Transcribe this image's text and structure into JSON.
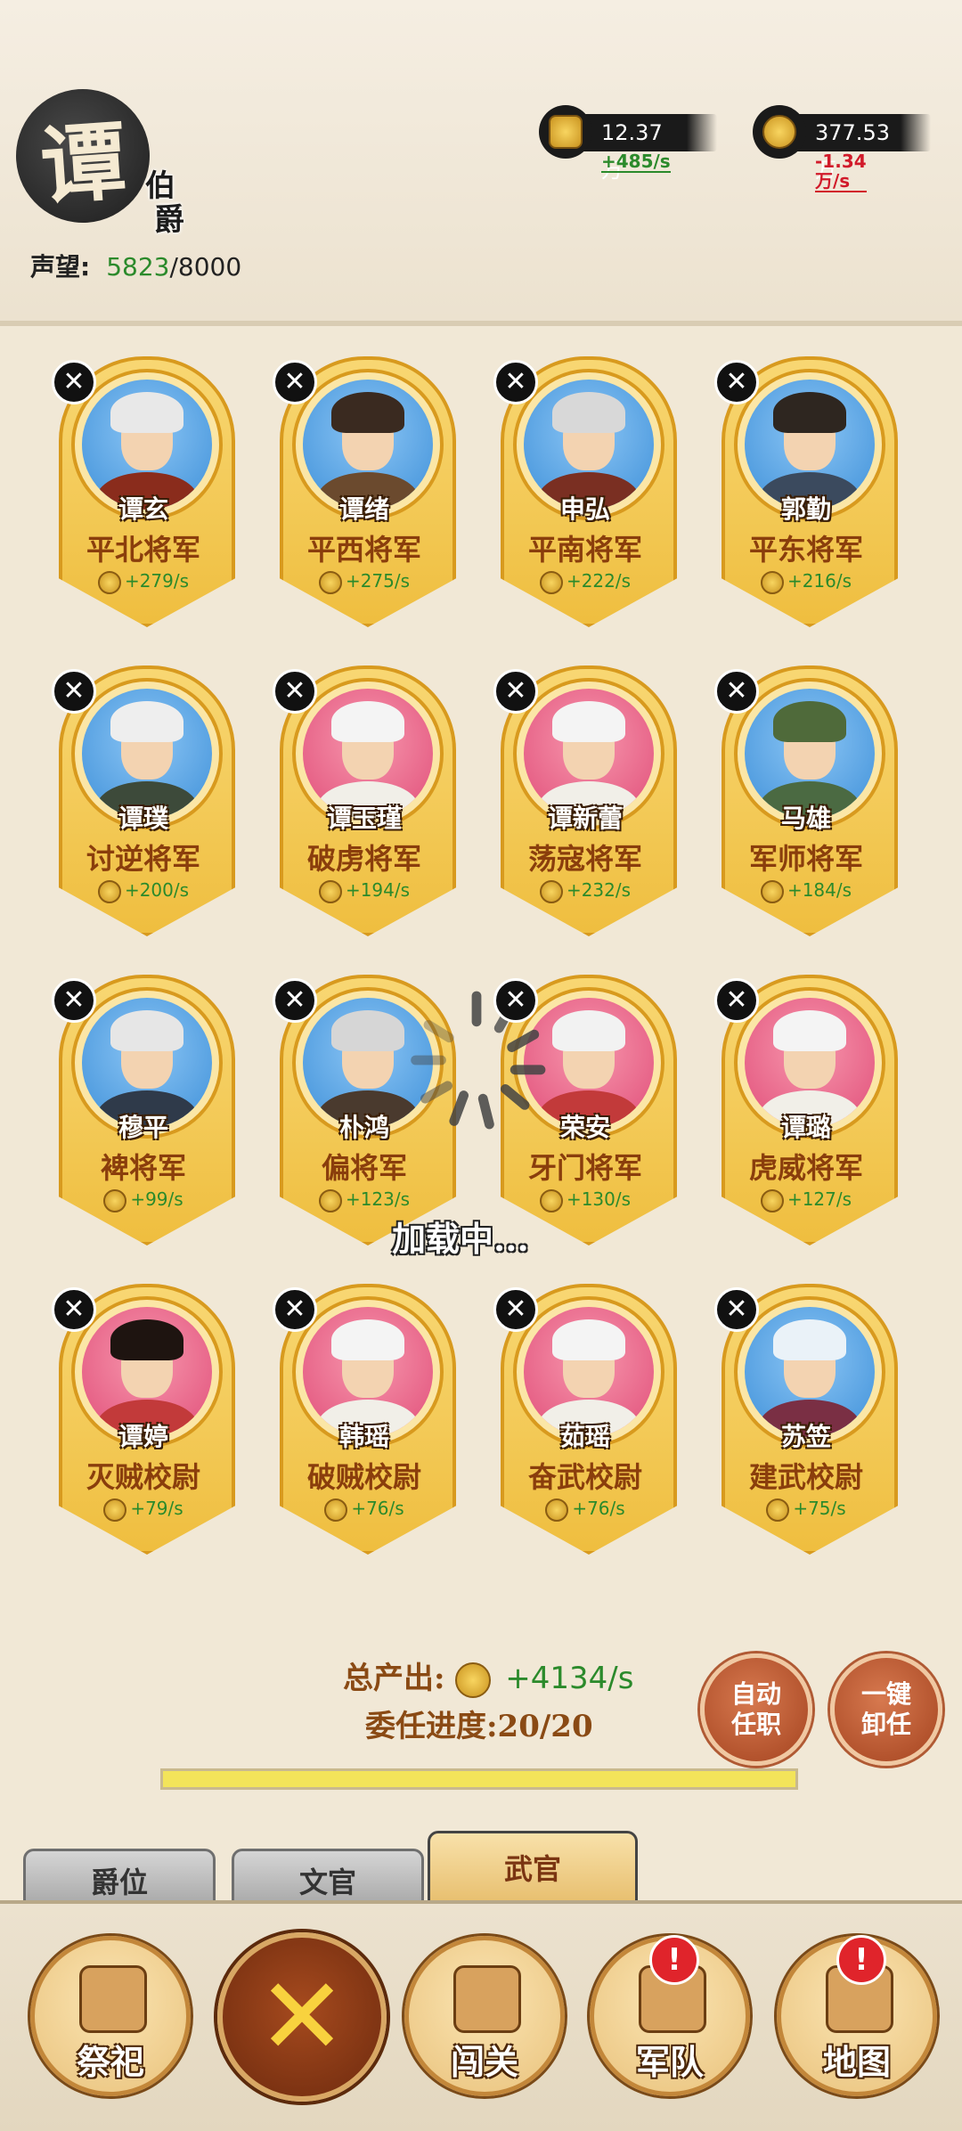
{
  "header": {
    "rank_char": "谭",
    "rank_title": [
      "伯",
      "爵"
    ],
    "reputation_label": "声望:",
    "reputation_current": "5823",
    "reputation_max": "/8000",
    "resources": [
      {
        "icon": "grain-icon",
        "amount": "12.37万",
        "rate": "+485/s",
        "rate_color": "#2b8a2b"
      },
      {
        "icon": "coin-icon",
        "amount": "377.53万",
        "rate": "-1.34万/s",
        "rate_color": "#d11a2a"
      }
    ]
  },
  "officers": [
    {
      "name": "谭玄",
      "title": "平北将军",
      "output": "+279/s",
      "bg": "blue",
      "hair": "#e8e8e8",
      "robe": "#8a2c1c"
    },
    {
      "name": "谭绪",
      "title": "平西将军",
      "output": "+275/s",
      "bg": "blue",
      "hair": "#3a2a20",
      "robe": "#6b4a2e"
    },
    {
      "name": "申弘",
      "title": "平南将军",
      "output": "+222/s",
      "bg": "blue",
      "hair": "#d8d8d8",
      "robe": "#7a2f22"
    },
    {
      "name": "郭勤",
      "title": "平东将军",
      "output": "+216/s",
      "bg": "blue",
      "hair": "#2e2620",
      "robe": "#3b4a5e"
    },
    {
      "name": "谭璞",
      "title": "讨逆将军",
      "output": "+200/s",
      "bg": "blue",
      "hair": "#eeeeee",
      "robe": "#3d4a3a"
    },
    {
      "name": "谭玉瑾",
      "title": "破虏将军",
      "output": "+194/s",
      "bg": "pink",
      "hair": "#f4f4f4",
      "robe": "#f1efe8"
    },
    {
      "name": "谭新蕾",
      "title": "荡寇将军",
      "output": "+232/s",
      "bg": "pink",
      "hair": "#f4f4f4",
      "robe": "#f1efe8"
    },
    {
      "name": "马雄",
      "title": "军师将军",
      "output": "+184/s",
      "bg": "blue",
      "hair": "#4f6a3a",
      "robe": "#4b6a42"
    },
    {
      "name": "穆平",
      "title": "裨将军",
      "output": "+99/s",
      "bg": "blue",
      "hair": "#e6e6e6",
      "robe": "#2f3a4a"
    },
    {
      "name": "朴鸿",
      "title": "偏将军",
      "output": "+123/s",
      "bg": "blue",
      "hair": "#d6d6d6",
      "robe": "#4a3a2e"
    },
    {
      "name": "荣安",
      "title": "牙门将军",
      "output": "+130/s",
      "bg": "pink",
      "hair": "#f2f2f2",
      "robe": "#c23a3a"
    },
    {
      "name": "谭璐",
      "title": "虎威将军",
      "output": "+127/s",
      "bg": "pink",
      "hair": "#f4f4f4",
      "robe": "#f1efe8"
    },
    {
      "name": "谭婷",
      "title": "灭贼校尉",
      "output": "+79/s",
      "bg": "pink",
      "hair": "#1e1410",
      "robe": "#c23a3a"
    },
    {
      "name": "韩瑶",
      "title": "破贼校尉",
      "output": "+76/s",
      "bg": "pink",
      "hair": "#f4f4f4",
      "robe": "#f1efe8"
    },
    {
      "name": "茹瑶",
      "title": "奋武校尉",
      "output": "+76/s",
      "bg": "pink",
      "hair": "#f4f4f4",
      "robe": "#f1efe8"
    },
    {
      "name": "苏笠",
      "title": "建武校尉",
      "output": "+75/s",
      "bg": "blue",
      "hair": "#eaf2f8",
      "robe": "#7a2f44"
    }
  ],
  "loading": {
    "text": "加载中..."
  },
  "summary": {
    "total_label": "总产出:",
    "total_value": "+4134/s",
    "progress_label": "委任进度:20/20",
    "progress_fraction": 1.0
  },
  "actions": {
    "auto_assign": [
      "自动",
      "任职"
    ],
    "unload_all": [
      "一键",
      "卸任"
    ]
  },
  "tabs": [
    {
      "label": "爵位",
      "active": false
    },
    {
      "label": "文官",
      "active": false
    },
    {
      "label": "武官",
      "active": true
    }
  ],
  "bottom_nav": [
    {
      "label": "祭祀",
      "icon": "statue-icon",
      "alert": false
    },
    {
      "label": "",
      "icon": "crossed-swords-icon",
      "alert": false
    },
    {
      "label": "闯关",
      "icon": "banner-icon",
      "alert": false
    },
    {
      "label": "军队",
      "icon": "army-icon",
      "alert": true,
      "alert_mark": "!"
    },
    {
      "label": "地图",
      "icon": "scroll-map-icon",
      "alert": true,
      "alert_mark": "!"
    }
  ]
}
